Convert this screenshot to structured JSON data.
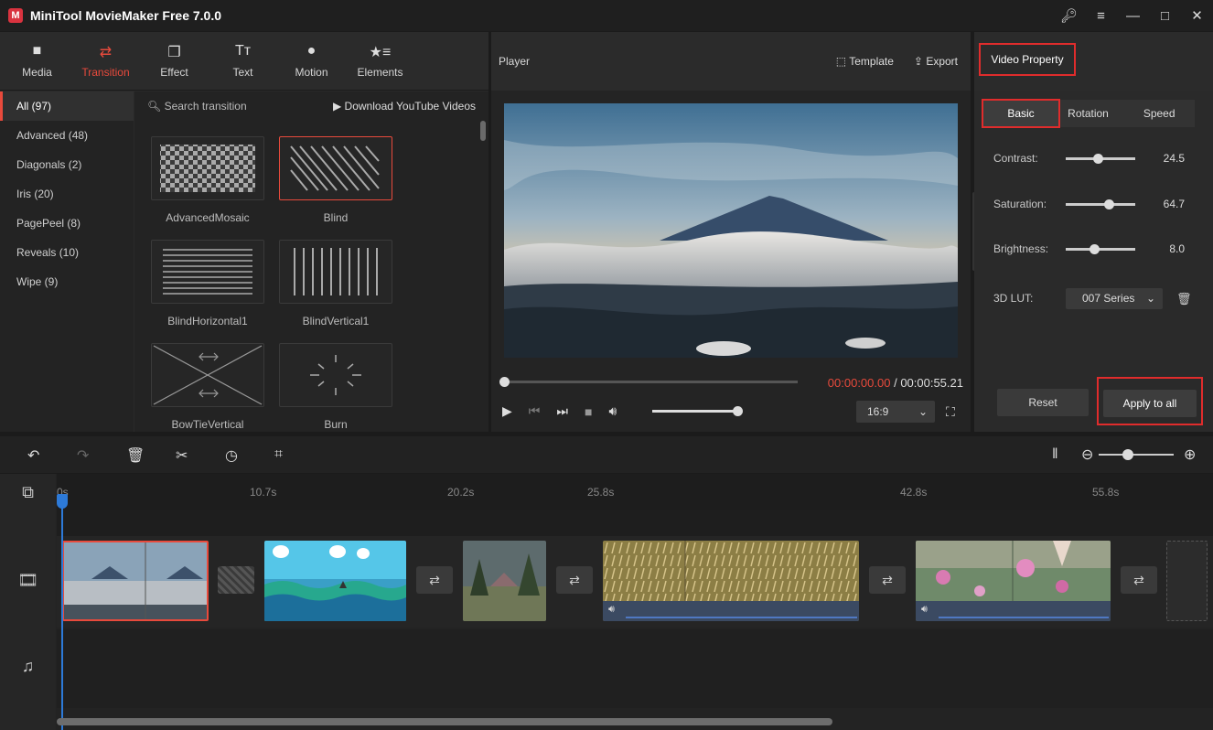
{
  "app": {
    "title": "MiniTool MovieMaker Free 7.0.0",
    "logo_glyph": "M"
  },
  "nav": {
    "tabs": [
      {
        "label": "Media",
        "icon": "folder-icon"
      },
      {
        "label": "Transition",
        "icon": "swap-arrows-icon"
      },
      {
        "label": "Effect",
        "icon": "layers-icon"
      },
      {
        "label": "Text",
        "icon": "text-icon"
      },
      {
        "label": "Motion",
        "icon": "motion-icon"
      },
      {
        "label": "Elements",
        "icon": "elements-icon"
      }
    ],
    "active": "Transition",
    "accent": "#e84a3c"
  },
  "categories": [
    "All (97)",
    "Advanced (48)",
    "Diagonals (2)",
    "Iris (20)",
    "PagePeel (8)",
    "Reveals (10)",
    "Wipe (9)"
  ],
  "transitions": {
    "search_placeholder": "Search transition",
    "download_label": "Download YouTube Videos",
    "items": [
      "AdvancedMosaic",
      "Blind",
      "BlindHorizontal1",
      "BlindVertical1",
      "BowTieVertical",
      "Burn"
    ],
    "selected": "Blind"
  },
  "player": {
    "title": "Player",
    "template_label": "Template",
    "export_label": "Export",
    "current_time": "00:00:00.00",
    "separator": " / ",
    "total_time": "00:00:55.21",
    "aspect_ratio": "16:9"
  },
  "property": {
    "title": "Video Property",
    "tabs": [
      "Basic",
      "Rotation",
      "Speed"
    ],
    "contrast_label": "Contrast:",
    "contrast_value": "24.5",
    "saturation_label": "Saturation:",
    "saturation_value": "64.7",
    "brightness_label": "Brightness:",
    "brightness_value": "8.0",
    "lut_label": "3D LUT:",
    "lut_value": "007 Series",
    "reset_label": "Reset",
    "apply_label": "Apply to all",
    "highlight_color": "#e02c2c"
  },
  "timeline": {
    "ticks": [
      "0s",
      "10.7s",
      "20.2s",
      "25.8s",
      "42.8s",
      "55.8s"
    ],
    "playhead_color": "#2d7ad8"
  }
}
